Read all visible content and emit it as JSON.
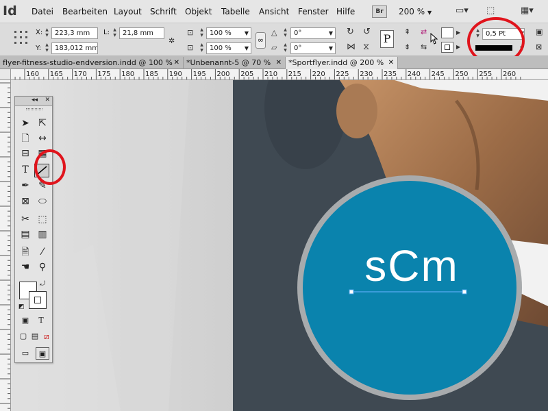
{
  "app": {
    "logo": "Id"
  },
  "menu": [
    "Datei",
    "Bearbeiten",
    "Layout",
    "Schrift",
    "Objekt",
    "Tabelle",
    "Ansicht",
    "Fenster",
    "Hilfe"
  ],
  "bridge_label": "Br",
  "zoom": "200 %",
  "control": {
    "x_label": "X:",
    "x_value": "223,3 mm",
    "y_label": "Y:",
    "y_value": "183,012 mm",
    "l_label": "L:",
    "l_value": "21,8 mm",
    "scale_x": "100 %",
    "scale_y": "100 %",
    "rotate": "0°",
    "shear": "0°",
    "stroke_weight": "0,5 Pt"
  },
  "tabs": [
    {
      "label": "flyer-fitness-studio-endversion.indd @ 100 %",
      "active": false
    },
    {
      "label": "*Unbenannt-5 @ 70 %",
      "active": false
    },
    {
      "label": "*Sportflyer.indd @ 200 %",
      "active": true
    }
  ],
  "ruler": {
    "labels": [
      "160",
      "165",
      "170",
      "175",
      "180",
      "185",
      "190",
      "195",
      "200",
      "205",
      "210",
      "215",
      "220",
      "225",
      "230",
      "235",
      "240",
      "245",
      "250",
      "255",
      "260"
    ]
  },
  "logo_text": "sCm",
  "colors": {
    "accent_blue": "#0a83ad",
    "dark_panel": "#3f4952",
    "highlight_red": "#e0141c"
  },
  "icons": {
    "selection": "selection-tool-icon",
    "direct": "direct-selection-tool-icon",
    "line": "line-tool-icon",
    "type": "type-tool-icon",
    "pen": "pen-tool-icon",
    "rect_frame": "rectangle-frame-tool-icon",
    "ellipse": "ellipse-tool-icon",
    "scissors": "scissors-tool-icon",
    "gradient": "gradient-tool-icon",
    "eyedropper": "eyedropper-tool-icon",
    "hand": "hand-tool-icon",
    "zoom": "zoom-tool-icon"
  }
}
